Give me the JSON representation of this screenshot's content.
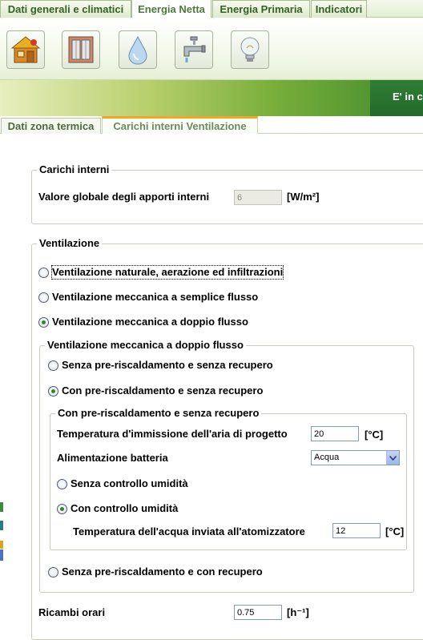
{
  "top_tabs": [
    "Dati generali e climatici",
    "Energia Netta",
    "Energia Primaria",
    "Indicatori"
  ],
  "toolbar": {
    "icons": [
      "house-icon",
      "window-icon",
      "water-drop-icon",
      "faucet-icon",
      "light-bulb-icon"
    ]
  },
  "banner": {
    "text": "E' in c"
  },
  "sub_tabs": [
    "Dati zona termica",
    "Carichi interni Ventilazione"
  ],
  "carichi_interni": {
    "title": "Carichi interni",
    "apporti_label": "Valore globale degli apporti interni",
    "apporti_value": "6",
    "apporti_unit": "[W/m²]"
  },
  "ventilazione": {
    "title": "Ventilazione",
    "options": [
      "Ventilazione naturale, aerazione ed infiltrazioni",
      "Ventilazione meccanica a semplice flusso",
      "Ventilazione meccanica a doppio flusso"
    ],
    "selected": "Ventilazione meccanica a doppio flusso",
    "doppio_flusso": {
      "title": "Ventilazione meccanica a doppio flusso",
      "options": [
        "Senza pre-riscaldamento e senza recupero",
        "Con pre-riscaldamento e senza recupero",
        "Senza pre-riscaldamento e con recupero"
      ],
      "selected": "Con pre-riscaldamento e senza recupero",
      "pre_riscaldamento": {
        "title": "Con pre-riscaldamento e senza recupero",
        "temp_immissione_label": "Temperatura d'immissione dell'aria di progetto",
        "temp_immissione_value": "20",
        "temp_unit": "[°C]",
        "alimentazione_label": "Alimentazione batteria",
        "alimentazione_value": "Acqua",
        "umidita_options": [
          "Senza controllo umidità",
          "Con controllo umidità"
        ],
        "umidita_selected": "Con controllo umidità",
        "temp_acqua_label": "Temperatura dell'acqua inviata all'atomizzatore",
        "temp_acqua_value": "12",
        "temp_acqua_unit": "[°C]"
      }
    },
    "ricambi_label": "Ricambi orari",
    "ricambi_value": "0.75",
    "ricambi_unit": "[h⁻¹]"
  },
  "colors": {
    "tab_text": "#34602a",
    "banner_dark": "#23692a",
    "radio_dot": "#2b8a2b",
    "active_tab_accent": "#f0a824"
  }
}
